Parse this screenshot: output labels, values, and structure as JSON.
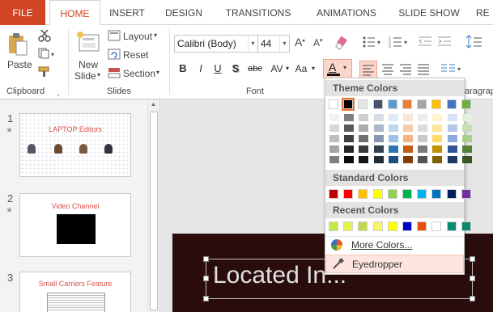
{
  "tabs": [
    {
      "label": "FILE"
    },
    {
      "label": "HOME"
    },
    {
      "label": "INSERT"
    },
    {
      "label": "DESIGN"
    },
    {
      "label": "TRANSITIONS"
    },
    {
      "label": "ANIMATIONS"
    },
    {
      "label": "SLIDE SHOW"
    },
    {
      "label": "RE"
    }
  ],
  "ribbon": {
    "clipboard": {
      "paste": "Paste",
      "label": "Clipboard"
    },
    "slides": {
      "new_slide_1": "New",
      "new_slide_2": "Slide",
      "layout": "Layout",
      "reset": "Reset",
      "section": "Section",
      "label": "Slides"
    },
    "font": {
      "name": "Calibri (Body)",
      "size": "44",
      "label": "Font",
      "bold": "B",
      "italic": "I",
      "underline": "U",
      "shadow": "S",
      "strike": "abc",
      "spacing": "AV",
      "case": "Aa",
      "color_letter": "A"
    },
    "paragraph": {
      "label": "aragrap"
    }
  },
  "slides": [
    {
      "num": "1",
      "title": "LAPTOP Editors"
    },
    {
      "num": "2",
      "title": "Video Channel"
    },
    {
      "num": "3",
      "title": "Small Carriers Feature"
    }
  ],
  "canvas": {
    "text": "Located In..."
  },
  "color_menu": {
    "theme_header": "Theme Colors",
    "standard_header": "Standard Colors",
    "recent_header": "Recent Colors",
    "more_colors": "More Colors...",
    "eyedropper": "Eyedropper",
    "theme_top": [
      "#ffffff",
      "#000000",
      "#e7e6e6",
      "#44546a",
      "#5b9bd5",
      "#ed7d31",
      "#a5a5a5",
      "#ffc000",
      "#4472c4",
      "#70ad47"
    ],
    "theme_shades": [
      [
        "#f2f2f2",
        "#7f7f7f",
        "#d0cece",
        "#d6dce4",
        "#deebf6",
        "#fbe5d5",
        "#ededed",
        "#fff2cc",
        "#dae3f3",
        "#e2efd9"
      ],
      [
        "#d8d8d8",
        "#595959",
        "#aeabab",
        "#adb9ca",
        "#bdd7ee",
        "#f7cbac",
        "#dbdbdb",
        "#fee599",
        "#b4c7e7",
        "#c5e0b3"
      ],
      [
        "#bfbfbf",
        "#3f3f3f",
        "#757070",
        "#8496b0",
        "#9dc3e6",
        "#f4b183",
        "#c9c9c9",
        "#ffd965",
        "#8eaadb",
        "#a8d08d"
      ],
      [
        "#a5a5a5",
        "#262626",
        "#3a3838",
        "#323f4f",
        "#2e75b5",
        "#c55a11",
        "#7b7b7b",
        "#bf9000",
        "#2f5496",
        "#538135"
      ],
      [
        "#7f7f7f",
        "#0c0c0c",
        "#171616",
        "#222a35",
        "#1e4e79",
        "#833c0b",
        "#525252",
        "#7f6000",
        "#1f3864",
        "#375623"
      ]
    ],
    "standard": [
      "#c00000",
      "#ff0000",
      "#ffc000",
      "#ffff00",
      "#92d050",
      "#00b050",
      "#00b0f0",
      "#0070c0",
      "#002060",
      "#7030a0"
    ],
    "recent": [
      "#c5e84b",
      "#e4f24a",
      "#c5d84b",
      "#f7f56b",
      "#ffff00",
      "#0000cc",
      "#e8500a",
      "#ffffff",
      "#0b8a6f",
      "#0b8a6f"
    ]
  }
}
